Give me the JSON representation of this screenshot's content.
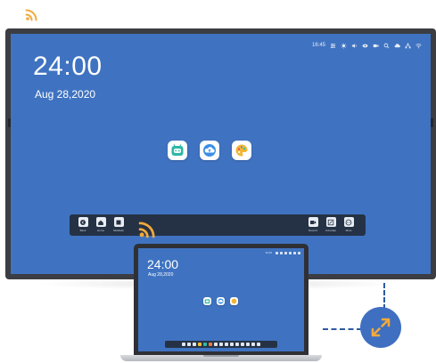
{
  "colors": {
    "screen_blue": "#3f73c1",
    "accent_orange": "#f2a93b",
    "frame_dark": "#3b3d42",
    "connector_blue": "#2e5aa0"
  },
  "display": {
    "clock_time": "24:00",
    "clock_date": "Aug 28,2020",
    "status_time": "16:45",
    "apps": [
      {
        "icon": "robot-assistant-icon",
        "color": "#2db8a6"
      },
      {
        "icon": "cloud-upload-icon",
        "color": "#3b8fe6"
      },
      {
        "icon": "palette-icon",
        "color": "#f2b533"
      }
    ],
    "taskbar_left": [
      {
        "icon": "back-icon",
        "label": "Back"
      },
      {
        "icon": "home-icon",
        "label": "Home"
      },
      {
        "icon": "multitask-icon",
        "label": "Multitask"
      }
    ],
    "taskbar_right": [
      {
        "icon": "record-icon",
        "label": "Record"
      },
      {
        "icon": "annotate-icon",
        "label": "Annotate"
      },
      {
        "icon": "more-icon",
        "label": "More"
      }
    ]
  },
  "laptop": {
    "clock_time": "24:00",
    "clock_date": "Aug 28,2020",
    "status_time": "16:45"
  }
}
